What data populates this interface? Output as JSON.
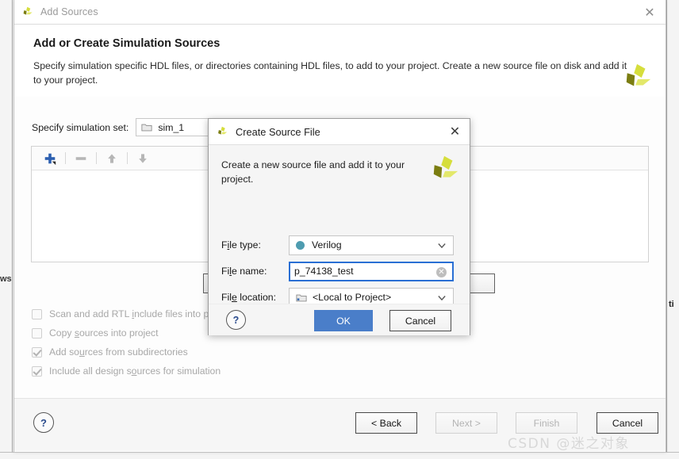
{
  "window": {
    "title": "Add Sources",
    "close_label": "✕",
    "logo_name": "xilinx-logo"
  },
  "header": {
    "heading": "Add or Create Simulation Sources",
    "description": "Specify simulation specific HDL files, or directories containing HDL files, to add to your project. Create a new source file on disk and add it to your project."
  },
  "simset": {
    "label": "Specify simulation set:",
    "value": "sim_1"
  },
  "filelist": {
    "toolbar": [
      {
        "name": "add-button",
        "glyph": "+",
        "enabled": true
      },
      {
        "name": "remove-button",
        "glyph": "−",
        "enabled": false
      },
      {
        "name": "move-up-button",
        "glyph": "↑",
        "enabled": false
      },
      {
        "name": "move-down-button",
        "glyph": "↓",
        "enabled": false
      }
    ],
    "rows": []
  },
  "options": [
    {
      "label_pre": "Scan and add RTL ",
      "label_u": "i",
      "label_post": "nclude files into p",
      "checked": false,
      "enabled": false
    },
    {
      "label_pre": "Copy ",
      "label_u": "s",
      "label_post": "ources into project",
      "checked": false,
      "enabled": false
    },
    {
      "label_pre": "Add so",
      "label_u": "u",
      "label_post": "rces from subdirectories",
      "checked": true,
      "enabled": false
    },
    {
      "label_pre": "Include all design s",
      "label_u": "o",
      "label_post": "urces for simulation",
      "checked": true,
      "enabled": false
    }
  ],
  "footer": {
    "help_label": "?",
    "buttons": [
      {
        "id": "back",
        "label": "< Back",
        "enabled": true
      },
      {
        "id": "next",
        "label": "Next >",
        "enabled": false
      },
      {
        "id": "finish",
        "label": "Finish",
        "enabled": false
      },
      {
        "id": "cancel",
        "label": "Cancel",
        "enabled": true
      }
    ]
  },
  "watermark": "CSDN @迷之对象",
  "dialog": {
    "title": "Create Source File",
    "close_label": "✕",
    "description": "Create a new source file and add it to your project.",
    "fields": {
      "file_type": {
        "label_pre": "F",
        "label_u": "i",
        "label_post": "le type:",
        "value": "Verilog",
        "dot_color": "#4e9cb0"
      },
      "file_name": {
        "label_pre": "Fi",
        "label_u": "l",
        "label_post": "e name:",
        "value": "p_74138_test",
        "placeholder": ""
      },
      "file_location": {
        "label_pre": "Fil",
        "label_u": "e",
        "label_post": " location:",
        "value": "<Local to Project>"
      }
    },
    "help_label": "?",
    "ok_label": "OK",
    "cancel_label": "Cancel",
    "ok_color": "#4a7ec9"
  },
  "background_fragments": {
    "left": "ws",
    "right": "ti"
  }
}
